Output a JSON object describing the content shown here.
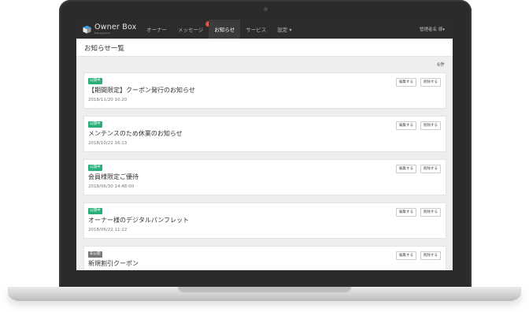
{
  "nav": {
    "brand_name": "Owner Box",
    "brand_sub": "Management",
    "items": [
      {
        "label": "オーナー"
      },
      {
        "label": "メッセージ",
        "badge": "3"
      },
      {
        "label": "お知らせ"
      },
      {
        "label": "サービス"
      },
      {
        "label": "設定 ▾"
      }
    ],
    "user": "管理者名 様▾"
  },
  "page": {
    "title": "お知らせ一覧",
    "count": "6件"
  },
  "colors": {
    "published": "#2bae7a",
    "unpublished": "#777777",
    "navbar": "#2c2c2c"
  },
  "buttons": {
    "edit": "編集する",
    "delete": "削除する"
  },
  "notices": [
    {
      "status": "公開中",
      "title": "【期間限定】クーポン発行のお知らせ",
      "date": "2018/11/20 10:20"
    },
    {
      "status": "公開中",
      "title": "メンテンスのため休業のお知らせ",
      "date": "2018/10/22 16:13"
    },
    {
      "status": "公開中",
      "title": "会員様限定ご優待",
      "date": "2018/06/30 14:48:00"
    },
    {
      "status": "公開中",
      "title": "オーナー様のデジタルパンフレット",
      "date": "2018/06/22 11:22"
    },
    {
      "status": "非公開",
      "title": "新規割引クーポン",
      "date": ""
    }
  ]
}
